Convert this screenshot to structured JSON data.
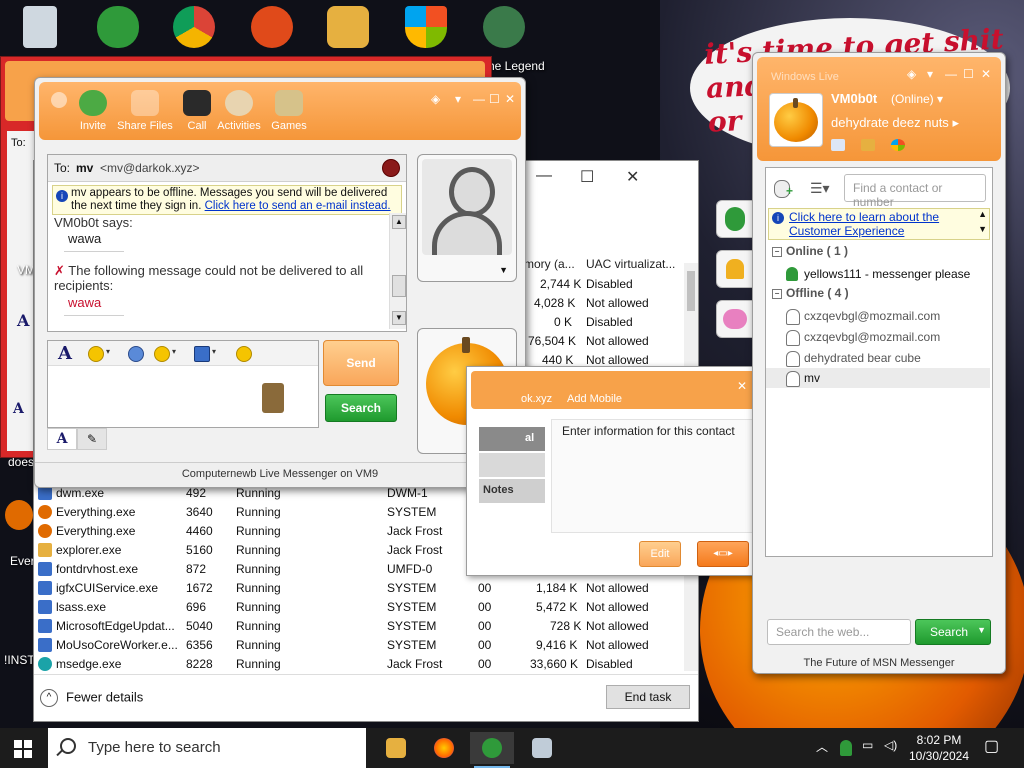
{
  "desktop": {
    "wallpaper_text": "it's time to get shit\nand\nor t",
    "labels": {
      "legend": "he Legend",
      "partial_vm": "VM",
      "does": "does",
      "ever": "Ever",
      "inst": "!INST"
    },
    "icons": [
      "recycle-bin-icon",
      "messenger-people-icon",
      "chrome-icon",
      "ppt-p-icon",
      "folder-icon",
      "shield-icon",
      "game-character-icon"
    ]
  },
  "task_manager": {
    "header": {
      "memory": "mory (a...",
      "uac": "UAC virtualizat..."
    },
    "upper_rows": [
      {
        "mem": "2,744 K",
        "uac": "Disabled"
      },
      {
        "mem": "4,028 K",
        "uac": "Not allowed"
      },
      {
        "mem": "0 K",
        "uac": "Disabled"
      },
      {
        "mem": "76,504 K",
        "uac": "Not allowed"
      },
      {
        "mem": "440 K",
        "uac": "Not allowed"
      }
    ],
    "rows": [
      {
        "name": "dwm.exe",
        "pid": "492",
        "status": "Running",
        "user": "DWM-1",
        "cpu": "",
        "mem": "",
        "uac": ""
      },
      {
        "name": "Everything.exe",
        "pid": "3640",
        "status": "Running",
        "user": "SYSTEM",
        "cpu": "",
        "mem": "",
        "uac": ""
      },
      {
        "name": "Everything.exe",
        "pid": "4460",
        "status": "Running",
        "user": "Jack Frost",
        "cpu": "",
        "mem": "",
        "uac": ""
      },
      {
        "name": "explorer.exe",
        "pid": "5160",
        "status": "Running",
        "user": "Jack Frost",
        "cpu": "",
        "mem": "",
        "uac": ""
      },
      {
        "name": "fontdrvhost.exe",
        "pid": "872",
        "status": "Running",
        "user": "UMFD-0",
        "cpu": "",
        "mem": "",
        "uac": ""
      },
      {
        "name": "igfxCUIService.exe",
        "pid": "1672",
        "status": "Running",
        "user": "SYSTEM",
        "cpu": "00",
        "mem": "1,184 K",
        "uac": "Not allowed"
      },
      {
        "name": "lsass.exe",
        "pid": "696",
        "status": "Running",
        "user": "SYSTEM",
        "cpu": "00",
        "mem": "5,472 K",
        "uac": "Not allowed"
      },
      {
        "name": "MicrosoftEdgeUpdat...",
        "pid": "5040",
        "status": "Running",
        "user": "SYSTEM",
        "cpu": "00",
        "mem": "728 K",
        "uac": "Not allowed"
      },
      {
        "name": "MoUsoCoreWorker.e...",
        "pid": "6356",
        "status": "Running",
        "user": "SYSTEM",
        "cpu": "00",
        "mem": "9,416 K",
        "uac": "Not allowed"
      },
      {
        "name": "msedge.exe",
        "pid": "8228",
        "status": "Running",
        "user": "Jack Frost",
        "cpu": "00",
        "mem": "33,660 K",
        "uac": "Disabled"
      }
    ],
    "fewer_details": "Fewer details",
    "end_task": "End task",
    "caption": {
      "minimize": "—",
      "maximize": "☐",
      "close": "✕"
    }
  },
  "chat": {
    "toolbar": [
      {
        "label": "Invite",
        "icon": "invite-icon"
      },
      {
        "label": "Share Files",
        "icon": "folder-icon"
      },
      {
        "label": "Call",
        "icon": "phone-icon"
      },
      {
        "label": "Activities",
        "icon": "activities-icon"
      },
      {
        "label": "Games",
        "icon": "games-icon"
      }
    ],
    "to_label": "To:",
    "to_name": "mv",
    "to_email": "<mv@darkok.xyz>",
    "info_text": "mv appears to be offline. Messages you send will be delivered the next time they sign in.",
    "info_link": "Click here to send an e-mail instead.",
    "sender_says": "VM0b0t says:",
    "message1": "wawa",
    "error_text": "The following message could not be delivered to all recipients:",
    "message2": "wawa",
    "send_label": "Send",
    "search_label": "Search",
    "font_button": "A",
    "status_text": "Computernewb Live Messenger on VM9"
  },
  "contact_card": {
    "header_email": "ok.xyz",
    "add_mobile": "Add Mobile",
    "tabs": [
      "al",
      "",
      "Notes"
    ],
    "body_text": "Enter information for this contact",
    "edit_label": "Edit",
    "close": "✕"
  },
  "messenger": {
    "title": "Windows Live",
    "name": "VM0b0t",
    "status": "(Online)",
    "psm": "dehydrate deez nuts",
    "find_placeholder": "Find a contact or number",
    "ce_link": "Click here to learn about the Customer Experience",
    "online_group": "Online ( 1 )",
    "offline_group": "Offline ( 4 )",
    "online_contacts": [
      "yellows111 - messenger please"
    ],
    "offline_contacts": [
      "cxzqevbgl@mozmail.com",
      "cxzqevbgl@mozmail.com",
      "dehydrated bear cube",
      "mv"
    ],
    "web_search_placeholder": "Search the web...",
    "search_label": "Search",
    "footer": "The Future of MSN Messenger"
  },
  "taskbar": {
    "search_placeholder": "Type here to search",
    "time": "8:02 PM",
    "date": "10/30/2024",
    "apps": [
      "file-explorer-icon",
      "firefox-icon",
      "messenger-icon",
      "remote-desktop-icon"
    ]
  },
  "colors": {
    "msn_orange": "#f59639",
    "search_green": "#1f9a2e",
    "error_red": "#c8102e",
    "link_blue": "#0033cc"
  }
}
